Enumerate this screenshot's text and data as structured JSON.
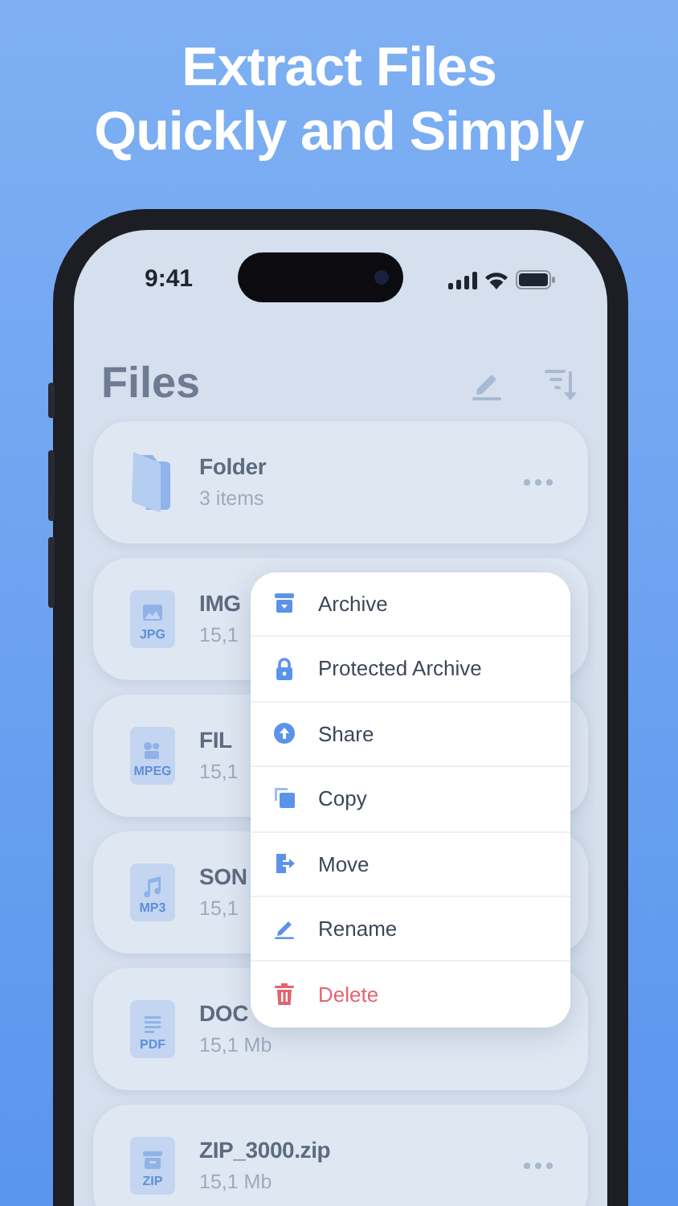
{
  "headline": [
    "Extract Files",
    "Quickly and Simply"
  ],
  "status_bar": {
    "time": "9:41"
  },
  "screen_title": "Files",
  "items": [
    {
      "kind": "folder",
      "name": "Folder",
      "detail": "3 items",
      "more": true
    },
    {
      "kind": "file",
      "type": "JPG",
      "name": "IMG",
      "detail": "15,1",
      "more": false
    },
    {
      "kind": "file",
      "type": "MPEG",
      "name": "FIL",
      "detail": "15,1",
      "more": false
    },
    {
      "kind": "file",
      "type": "MP3",
      "name": "SON",
      "detail": "15,1",
      "more": false
    },
    {
      "kind": "file",
      "type": "PDF",
      "name": "DOC",
      "detail": "15,1 Mb",
      "more": false
    },
    {
      "kind": "file",
      "type": "ZIP",
      "name": "ZIP_3000.zip",
      "detail": "15,1 Mb",
      "more": true
    }
  ],
  "context_menu": [
    {
      "label": "Archive",
      "destructive": false
    },
    {
      "label": "Protected Archive",
      "destructive": false
    },
    {
      "label": "Share",
      "destructive": false
    },
    {
      "label": "Copy",
      "destructive": false
    },
    {
      "label": "Move",
      "destructive": false
    },
    {
      "label": "Rename",
      "destructive": false
    },
    {
      "label": "Delete",
      "destructive": true
    }
  ]
}
